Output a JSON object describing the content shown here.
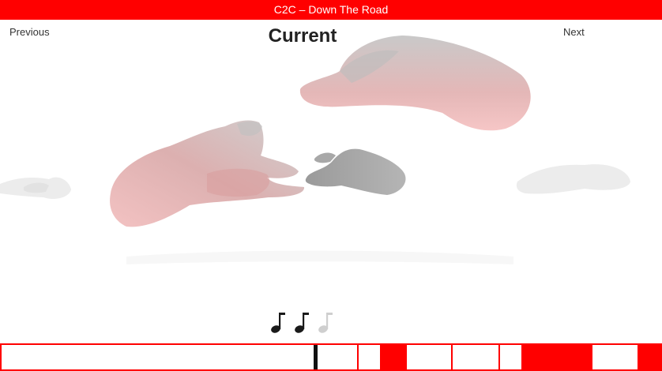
{
  "header": {
    "title": "C2C – Down The Road"
  },
  "nav": {
    "previous_label": "Previous",
    "next_label": "Next",
    "current_label": "Current"
  },
  "note_indicators": {
    "total": 3,
    "played": 2
  },
  "colors": {
    "accent": "#ff0000",
    "text": "#333333",
    "note_active": "#1a1a1a",
    "note_inactive": "#cfcfcf"
  }
}
